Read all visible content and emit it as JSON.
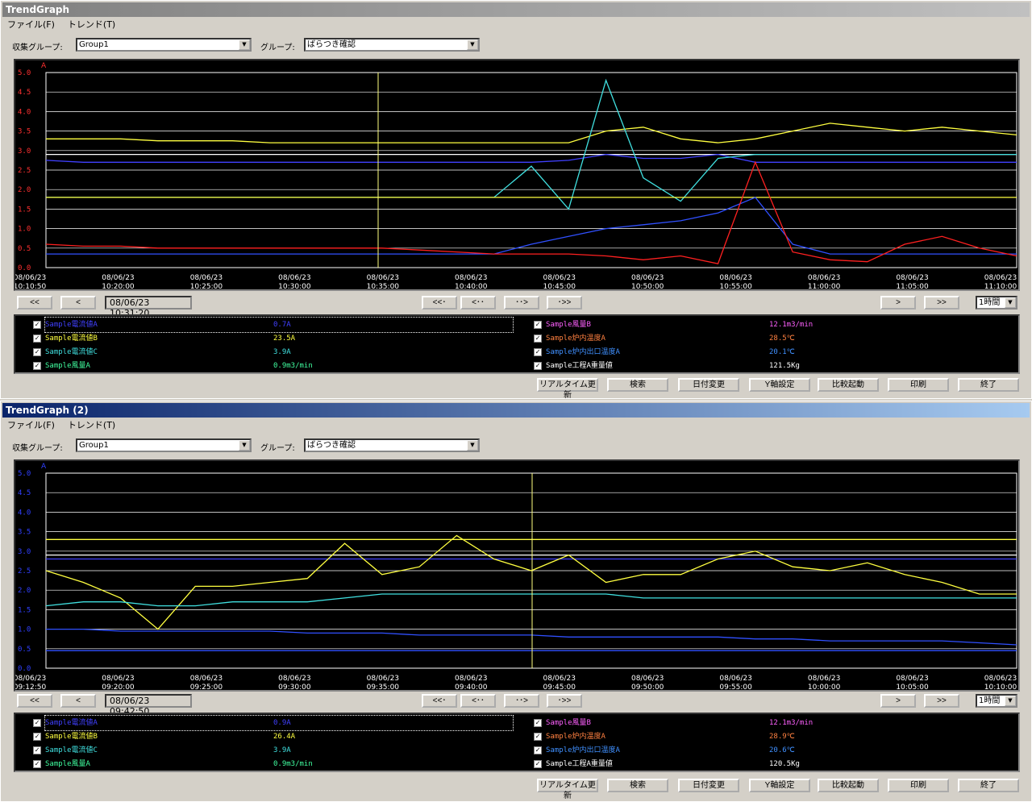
{
  "windows": [
    {
      "title": "TrendGraph",
      "menu": [
        "ファイル(F)",
        "トレンド(T)"
      ],
      "collect_group_label": "収集グループ:",
      "collect_group_value": "Group1",
      "group_label": "グループ:",
      "group_value": "ばらつき確認",
      "axis_unit": "A",
      "y_ticks": [
        "5.0",
        "4.5",
        "4.0",
        "3.5",
        "3.0",
        "2.5",
        "2.0",
        "1.5",
        "1.0",
        "0.5",
        "0.0"
      ],
      "x_ticks": [
        {
          "date": "08/06/23",
          "time": "10:10:50"
        },
        {
          "date": "08/06/23",
          "time": "10:20:00"
        },
        {
          "date": "08/06/23",
          "time": "10:25:00"
        },
        {
          "date": "08/06/23",
          "time": "10:30:00"
        },
        {
          "date": "08/06/23",
          "time": "10:35:00"
        },
        {
          "date": "08/06/23",
          "time": "10:40:00"
        },
        {
          "date": "08/06/23",
          "time": "10:45:00"
        },
        {
          "date": "08/06/23",
          "time": "10:50:00"
        },
        {
          "date": "08/06/23",
          "time": "10:55:00"
        },
        {
          "date": "08/06/23",
          "time": "11:00:00"
        },
        {
          "date": "08/06/23",
          "time": "11:05:00"
        },
        {
          "date": "08/06/23",
          "time": "11:10:00"
        }
      ],
      "nav": {
        "first": "<<",
        "prev": "<",
        "cursor_time": "08/06/23 10:31:20",
        "far_left": "<<･",
        "left": "<･･",
        "right": "･･>",
        "far_right": "･>>",
        "next": ">",
        "last": ">>",
        "range": "1時間"
      },
      "legend": [
        {
          "name": "Sample電流値A",
          "value": "0.7A",
          "color": "#4040ff"
        },
        {
          "name": "Sample電流値B",
          "value": "23.5A",
          "color": "#ffff40"
        },
        {
          "name": "Sample電流値C",
          "value": "3.9A",
          "color": "#40e0e0"
        },
        {
          "name": "Sample風量A",
          "value": "0.9m3/min",
          "color": "#40ffa0"
        },
        {
          "name": "Sample風量B",
          "value": "12.1m3/min",
          "color": "#ff60ff"
        },
        {
          "name": "Sample炉内温度A",
          "value": "28.5℃",
          "color": "#ff8040"
        },
        {
          "name": "Sample炉内出口温度A",
          "value": "20.1℃",
          "color": "#4090ff"
        },
        {
          "name": "Sample工程A重量値",
          "value": "121.5Kg",
          "color": "#ffffff"
        }
      ],
      "buttons": [
        "リアルタイム更新",
        "検索",
        "日付変更",
        "Y軸設定",
        "比較起動",
        "印刷",
        "終了"
      ]
    },
    {
      "title": "TrendGraph (2)",
      "menu": [
        "ファイル(F)",
        "トレンド(T)"
      ],
      "collect_group_label": "収集グループ:",
      "collect_group_value": "Group1",
      "group_label": "グループ:",
      "group_value": "ばらつき確認",
      "axis_unit": "A",
      "y_ticks": [
        "5.0",
        "4.5",
        "4.0",
        "3.5",
        "3.0",
        "2.5",
        "2.0",
        "1.5",
        "1.0",
        "0.5",
        "0.0"
      ],
      "x_ticks": [
        {
          "date": "08/06/23",
          "time": "09:12:50"
        },
        {
          "date": "08/06/23",
          "time": "09:20:00"
        },
        {
          "date": "08/06/23",
          "time": "09:25:00"
        },
        {
          "date": "08/06/23",
          "time": "09:30:00"
        },
        {
          "date": "08/06/23",
          "time": "09:35:00"
        },
        {
          "date": "08/06/23",
          "time": "09:40:00"
        },
        {
          "date": "08/06/23",
          "time": "09:45:00"
        },
        {
          "date": "08/06/23",
          "time": "09:50:00"
        },
        {
          "date": "08/06/23",
          "time": "09:55:00"
        },
        {
          "date": "08/06/23",
          "time": "10:00:00"
        },
        {
          "date": "08/06/23",
          "time": "10:05:00"
        },
        {
          "date": "08/06/23",
          "time": "10:10:00"
        }
      ],
      "nav": {
        "first": "<<",
        "prev": "<",
        "cursor_time": "08/06/23 09:42:50",
        "far_left": "<<･",
        "left": "<･･",
        "right": "･･>",
        "far_right": "･>>",
        "next": ">",
        "last": ">>",
        "range": "1時間"
      },
      "legend": [
        {
          "name": "Sample電流値A",
          "value": "0.9A",
          "color": "#4040ff"
        },
        {
          "name": "Sample電流値B",
          "value": "26.4A",
          "color": "#ffff40"
        },
        {
          "name": "Sample電流値C",
          "value": "3.9A",
          "color": "#40e0e0"
        },
        {
          "name": "Sample風量A",
          "value": "0.9m3/min",
          "color": "#40ffa0"
        },
        {
          "name": "Sample風量B",
          "value": "12.1m3/min",
          "color": "#ff60ff"
        },
        {
          "name": "Sample炉内温度A",
          "value": "28.9℃",
          "color": "#ff8040"
        },
        {
          "name": "Sample炉内出口温度A",
          "value": "20.6℃",
          "color": "#4090ff"
        },
        {
          "name": "Sample工程A重量値",
          "value": "120.5Kg",
          "color": "#ffffff"
        }
      ],
      "buttons": [
        "リアルタイム更新",
        "検索",
        "日付変更",
        "Y軸設定",
        "比較起動",
        "印刷",
        "終了"
      ]
    }
  ],
  "chart_data": [
    {
      "type": "line",
      "ylim": [
        0,
        5
      ],
      "y_axis_color": "#ff3030",
      "cursor_time": "10:31:20",
      "series": [
        {
          "color": "#ffff40",
          "values": [
            3.3,
            3.3,
            3.3,
            3.25,
            3.25,
            3.25,
            3.2,
            3.2,
            3.2,
            3.2,
            3.2,
            3.2,
            3.2,
            3.2,
            3.2,
            3.5,
            3.6,
            3.3,
            3.2,
            3.3,
            3.5,
            3.7,
            3.6,
            3.5,
            3.6,
            3.5,
            3.4
          ]
        },
        {
          "color": "#ffffff",
          "values": [
            2.9,
            2.9,
            2.9,
            2.9,
            2.9,
            2.9,
            2.9,
            2.9,
            2.9,
            2.9,
            2.9,
            2.9,
            2.9,
            2.9,
            2.9,
            2.9,
            2.9,
            2.9,
            2.9,
            2.9,
            2.9,
            2.9,
            2.9,
            2.9,
            2.9,
            2.9,
            2.9
          ]
        },
        {
          "color": "#4040ff",
          "values": [
            2.75,
            2.7,
            2.7,
            2.7,
            2.7,
            2.7,
            2.7,
            2.7,
            2.7,
            2.7,
            2.7,
            2.7,
            2.7,
            2.7,
            2.75,
            2.9,
            2.8,
            2.8,
            2.9,
            2.7,
            2.7,
            2.7,
            2.7,
            2.7,
            2.7,
            2.7,
            2.7
          ]
        },
        {
          "color": "#40e0e0",
          "values": [
            1.8,
            1.8,
            1.8,
            1.8,
            1.8,
            1.8,
            1.8,
            1.8,
            1.8,
            1.8,
            1.8,
            1.8,
            1.8,
            2.6,
            1.5,
            4.8,
            2.3,
            1.7,
            2.8,
            2.9,
            2.9,
            2.9,
            2.9,
            2.9,
            2.9,
            2.9,
            2.9
          ]
        },
        {
          "color": "#ffff40",
          "values": [
            1.8,
            1.8,
            1.8,
            1.8,
            1.8,
            1.8,
            1.8,
            1.8,
            1.8,
            1.8,
            1.8,
            1.8,
            1.8,
            1.8,
            1.8,
            1.8,
            1.8,
            1.8,
            1.8,
            1.8,
            1.8,
            1.8,
            1.8,
            1.8,
            1.8,
            1.8,
            1.8
          ]
        },
        {
          "color": "#3050ff",
          "values": [
            0.35,
            0.35,
            0.35,
            0.35,
            0.35,
            0.35,
            0.35,
            0.35,
            0.35,
            0.35,
            0.35,
            0.35,
            0.35,
            0.6,
            0.8,
            1.0,
            1.1,
            1.2,
            1.4,
            1.8,
            0.6,
            0.35,
            0.35,
            0.35,
            0.35,
            0.35,
            0.35
          ]
        },
        {
          "color": "#ff2020",
          "values": [
            0.6,
            0.55,
            0.55,
            0.5,
            0.5,
            0.5,
            0.5,
            0.5,
            0.5,
            0.5,
            0.45,
            0.4,
            0.35,
            0.35,
            0.35,
            0.3,
            0.2,
            0.3,
            0.1,
            2.7,
            0.4,
            0.2,
            0.15,
            0.6,
            0.8,
            0.5,
            0.3
          ]
        }
      ]
    },
    {
      "type": "line",
      "ylim": [
        0,
        5
      ],
      "y_axis_color": "#3040ff",
      "cursor_time": "09:42:50",
      "series": [
        {
          "color": "#ffff40",
          "values": [
            3.3,
            3.3,
            3.3,
            3.3,
            3.3,
            3.3,
            3.3,
            3.3,
            3.3,
            3.3,
            3.3,
            3.3,
            3.3,
            3.3,
            3.3,
            3.3,
            3.3,
            3.3,
            3.3,
            3.3,
            3.3,
            3.3,
            3.3,
            3.3,
            3.3,
            3.3,
            3.3
          ]
        },
        {
          "color": "#ffffff",
          "values": [
            2.9,
            2.9,
            2.9,
            2.9,
            2.9,
            2.9,
            2.9,
            2.9,
            2.9,
            2.9,
            2.9,
            2.9,
            2.9,
            2.9,
            2.9,
            2.9,
            2.9,
            2.9,
            2.9,
            2.9,
            2.9,
            2.9,
            2.9,
            2.9,
            2.9,
            2.9,
            2.9
          ]
        },
        {
          "color": "#4040ff",
          "values": [
            2.8,
            2.8,
            2.8,
            2.8,
            2.8,
            2.8,
            2.8,
            2.8,
            2.8,
            2.8,
            2.8,
            2.8,
            2.8,
            2.8,
            2.8,
            2.8,
            2.8,
            2.8,
            2.8,
            2.8,
            2.8,
            2.8,
            2.8,
            2.8,
            2.8,
            2.8,
            2.8
          ]
        },
        {
          "color": "#ffff40",
          "values": [
            2.5,
            2.2,
            1.8,
            1.0,
            2.1,
            2.1,
            2.2,
            2.3,
            3.2,
            2.4,
            2.6,
            3.4,
            2.8,
            2.5,
            2.9,
            2.2,
            2.4,
            2.4,
            2.8,
            3.0,
            2.6,
            2.5,
            2.7,
            2.4,
            2.2,
            1.9,
            1.9
          ]
        },
        {
          "color": "#40e0e0",
          "values": [
            1.6,
            1.7,
            1.7,
            1.6,
            1.6,
            1.7,
            1.7,
            1.7,
            1.8,
            1.9,
            1.9,
            1.9,
            1.9,
            1.9,
            1.9,
            1.9,
            1.8,
            1.8,
            1.8,
            1.8,
            1.8,
            1.8,
            1.8,
            1.8,
            1.8,
            1.8,
            1.8
          ]
        },
        {
          "color": "#3050ff",
          "values": [
            1.0,
            1.0,
            0.95,
            0.95,
            0.95,
            0.95,
            0.95,
            0.9,
            0.9,
            0.9,
            0.85,
            0.85,
            0.85,
            0.85,
            0.8,
            0.8,
            0.8,
            0.8,
            0.8,
            0.75,
            0.75,
            0.7,
            0.7,
            0.7,
            0.7,
            0.65,
            0.6
          ]
        },
        {
          "color": "#3050ff",
          "values": [
            0.45,
            0.45,
            0.45,
            0.45,
            0.45,
            0.45,
            0.45,
            0.45,
            0.45,
            0.45,
            0.45,
            0.45,
            0.45,
            0.45,
            0.45,
            0.45,
            0.45,
            0.45,
            0.45,
            0.45,
            0.45,
            0.45,
            0.45,
            0.45,
            0.45,
            0.45,
            0.45
          ]
        }
      ]
    }
  ]
}
